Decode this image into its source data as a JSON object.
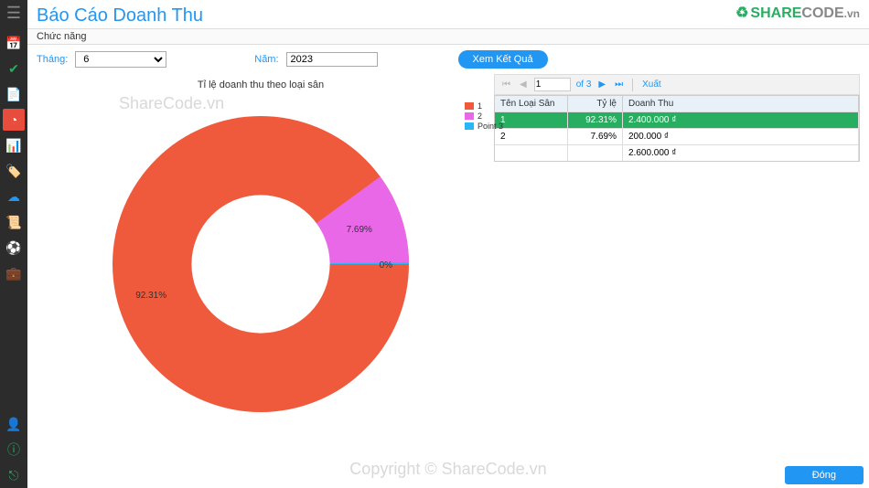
{
  "app": {
    "title": "Báo Cáo Doanh Thu",
    "logo_share": "SHARE",
    "logo_code": "CODE",
    "logo_vn": ".vn",
    "func_label": "Chức năng",
    "close_label": "Đóng"
  },
  "filters": {
    "month_label": "Tháng:",
    "month_value": "6",
    "year_label": "Năm:",
    "year_value": "2023",
    "view_label": "Xem Kết Quả"
  },
  "chart_data": {
    "type": "pie",
    "title": "Tỉ lệ doanh thu theo loại sân",
    "series": [
      {
        "name": "1",
        "value": 92.31,
        "label": "92.31%",
        "color": "#f05a3c"
      },
      {
        "name": "2",
        "value": 7.69,
        "label": "7.69%",
        "color": "#e868e8"
      },
      {
        "name": "Point 3",
        "value": 0,
        "label": "0%",
        "color": "#29b6f6"
      }
    ],
    "legend": [
      "1",
      "2",
      "Point 3"
    ]
  },
  "pager": {
    "page": "1",
    "of_label": "of 3",
    "export_label": "Xuất"
  },
  "table": {
    "headers": {
      "c1": "Tên Loại Sân",
      "c2": "Tỷ lệ",
      "c3": "Doanh Thu"
    },
    "rows": [
      {
        "c1": "1",
        "c2": "92.31%",
        "c3": "2.400.000 ₫",
        "selected": true
      },
      {
        "c1": "2",
        "c2": "7.69%",
        "c3": "200.000 ₫",
        "selected": false
      },
      {
        "c1": "",
        "c2": "",
        "c3": "2.600.000 ₫",
        "selected": false
      }
    ]
  },
  "watermark": {
    "w1": "ShareCode.vn",
    "w2": "Copyright © ShareCode.vn"
  },
  "colors": {
    "accent": "#2196F3",
    "slice1": "#f05a3c",
    "slice2": "#e868e8",
    "slice3": "#29b6f6",
    "selected_row": "#27ae60"
  }
}
